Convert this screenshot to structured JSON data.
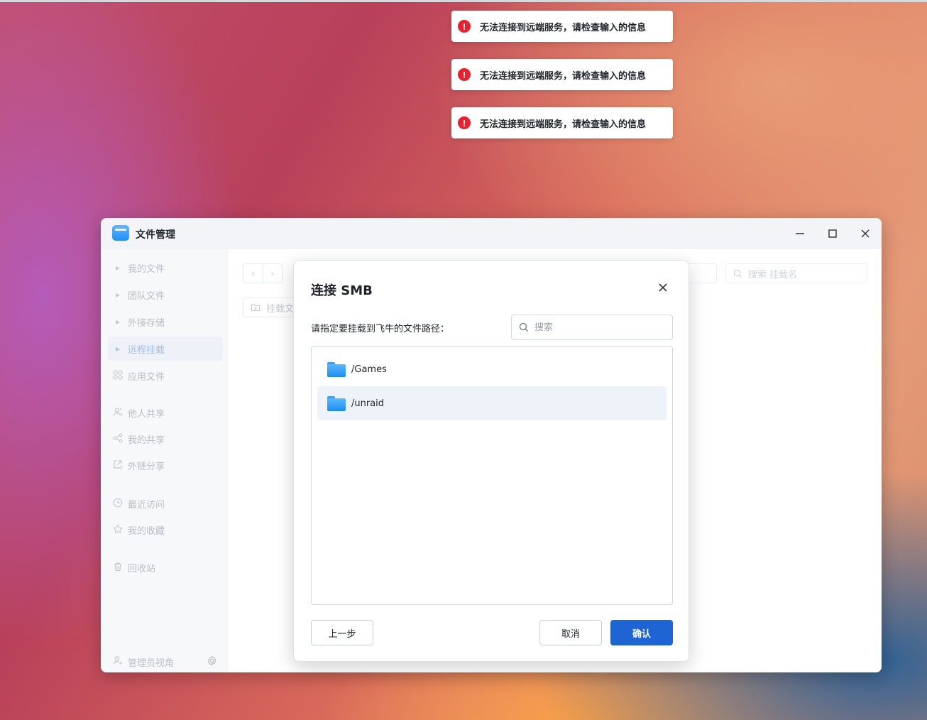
{
  "toasts": [
    {
      "text": "无法连接到远端服务，请检查输入的信息"
    },
    {
      "text": "无法连接到远端服务，请检查输入的信息"
    },
    {
      "text": "无法连接到远端服务，请检查输入的信息"
    }
  ],
  "window": {
    "title": "文件管理",
    "controls": {
      "minimize": "—",
      "maximize": "☐",
      "close": "✕"
    }
  },
  "sidebar": {
    "items": [
      {
        "label": "我的文件",
        "icon": "caret-right-icon"
      },
      {
        "label": "团队文件",
        "icon": "caret-right-icon"
      },
      {
        "label": "外接存储",
        "icon": "caret-right-icon"
      },
      {
        "label": "远程挂载",
        "icon": "caret-right-icon",
        "active": true
      },
      {
        "label": "应用文件",
        "icon": "apps-grid-icon"
      },
      {
        "label": "他人共享",
        "icon": "users-icon"
      },
      {
        "label": "我的共享",
        "icon": "share-icon"
      },
      {
        "label": "外链分享",
        "icon": "external-link-icon"
      },
      {
        "label": "最近访问",
        "icon": "clock-icon"
      },
      {
        "label": "我的收藏",
        "icon": "star-icon"
      },
      {
        "label": "回收站",
        "icon": "trash-icon"
      }
    ],
    "footer": {
      "label": "管理员视角",
      "icon": "admin-user-icon",
      "settings_icon": "gear-icon"
    }
  },
  "content": {
    "mount_button_label": "挂载文",
    "search_mount_placeholder": "搜索 挂载名"
  },
  "modal": {
    "title": "连接 SMB",
    "close_icon": "close-icon",
    "path_label": "请指定要挂载到飞牛的文件路径：",
    "search_placeholder": "搜索",
    "folders": [
      {
        "name": "/Games",
        "selected": false
      },
      {
        "name": "/unraid",
        "selected": true
      }
    ],
    "buttons": {
      "back": "上一步",
      "cancel": "取消",
      "confirm": "确认"
    }
  },
  "colors": {
    "primary": "#1e65d3",
    "error": "#e8212e",
    "folder": "#1d8cf0",
    "selected_row": "#eef3fa"
  }
}
